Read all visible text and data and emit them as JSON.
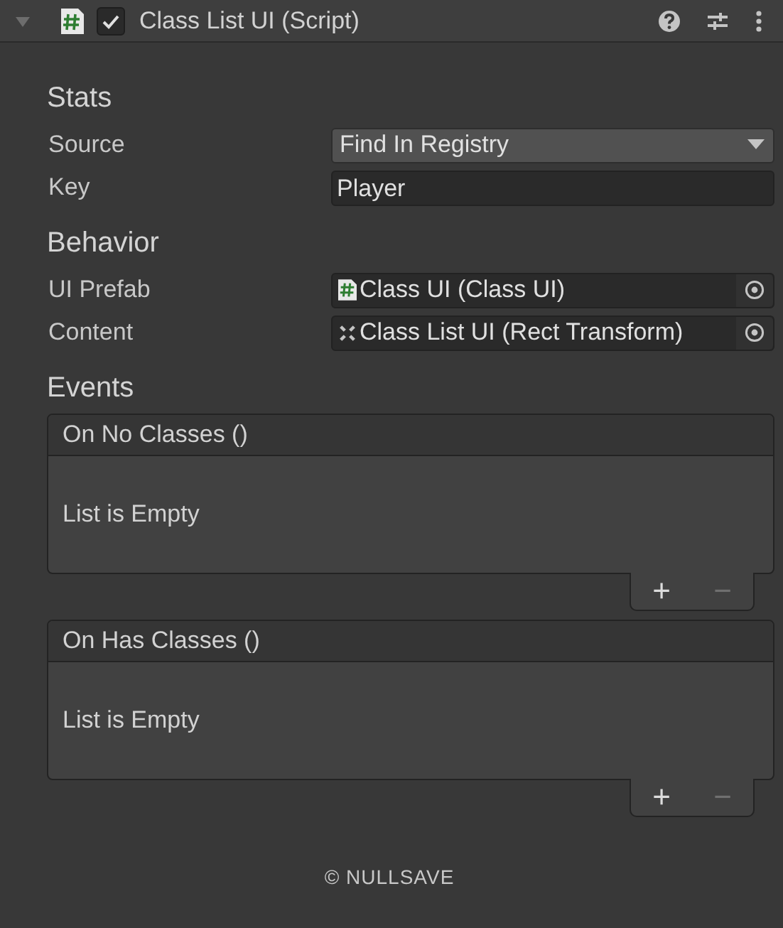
{
  "component": {
    "title": "Class List UI (Script)",
    "enabled": true,
    "expanded": true
  },
  "sections": [
    {
      "title": "Stats",
      "fields": [
        {
          "kind": "dropdown",
          "label": "Source",
          "value": "Find In Registry"
        },
        {
          "kind": "text",
          "label": "Key",
          "value": "Player"
        }
      ]
    },
    {
      "title": "Behavior",
      "fields": [
        {
          "kind": "script_object",
          "label": "UI Prefab",
          "value": "Class UI (Class UI)"
        },
        {
          "kind": "transform_object",
          "label": "Content",
          "value": "Class List UI (Rect Transform)"
        }
      ]
    },
    {
      "title": "Events",
      "events": [
        {
          "title": "On No Classes ()",
          "empty_text": "List is Empty",
          "add": "+",
          "remove": "−",
          "remove_disabled": true
        },
        {
          "title": "On Has Classes ()",
          "empty_text": "List is Empty",
          "add": "+",
          "remove": "−",
          "remove_disabled": true
        }
      ]
    }
  ],
  "footer": "© NULLSAVE"
}
